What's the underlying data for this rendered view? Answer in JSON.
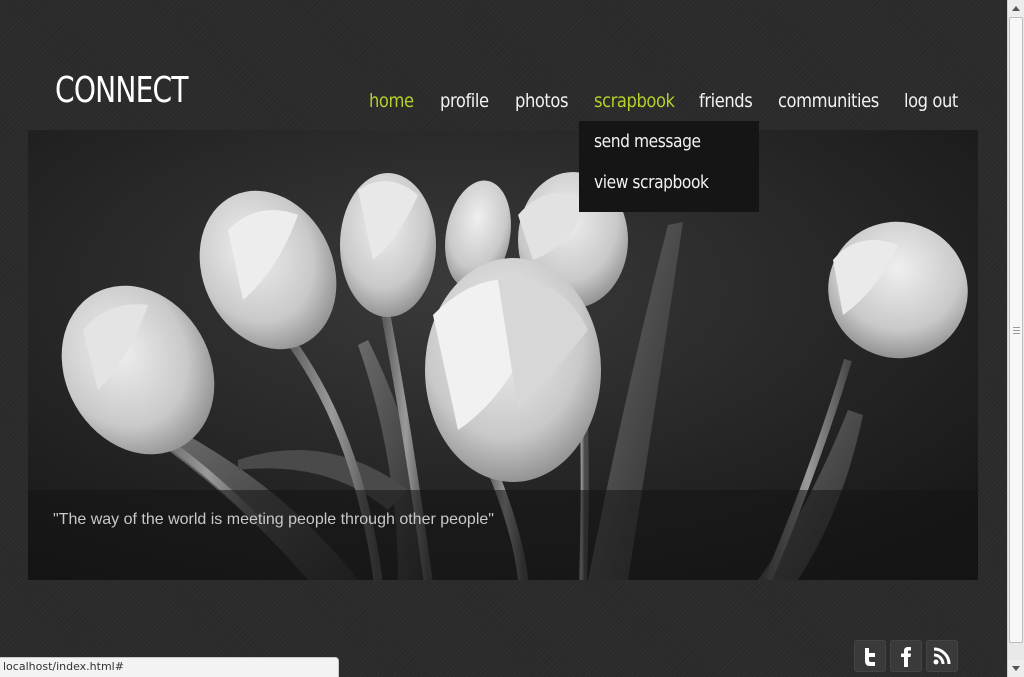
{
  "site": {
    "logo": "CONNECT"
  },
  "nav": {
    "items": [
      {
        "label": "home",
        "active": true
      },
      {
        "label": "profile",
        "active": false
      },
      {
        "label": "photos",
        "active": false
      },
      {
        "label": "scrapbook",
        "active": true
      },
      {
        "label": "friends",
        "active": false
      },
      {
        "label": "communities",
        "active": false
      },
      {
        "label": "log out",
        "active": false
      }
    ],
    "active_color": "#b6cf2c"
  },
  "dropdown": {
    "items": [
      "send message",
      "view scrapbook"
    ]
  },
  "hero": {
    "quote": "\"The way of the world is meeting people through other people\""
  },
  "social": {
    "icons": [
      "twitter-icon",
      "facebook-icon",
      "rss-icon"
    ]
  },
  "status_bar": {
    "url": "localhost/index.html#"
  }
}
